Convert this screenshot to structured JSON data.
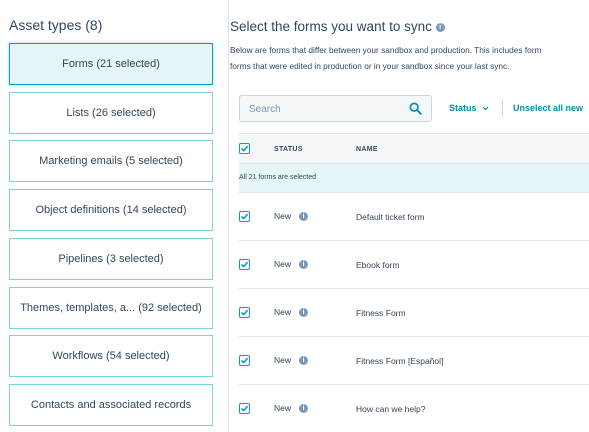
{
  "sidebar": {
    "title": "Asset types (8)",
    "items": [
      {
        "label": "Forms (21 selected)",
        "selected": true
      },
      {
        "label": "Lists (26 selected)",
        "selected": false
      },
      {
        "label": "Marketing emails (5 selected)",
        "selected": false
      },
      {
        "label": "Object definitions (14 selected)",
        "selected": false
      },
      {
        "label": "Pipelines (3 selected)",
        "selected": false
      },
      {
        "label": "Themes, templates, a... (92 selected)",
        "selected": false
      },
      {
        "label": "Workflows (54 selected)",
        "selected": false
      },
      {
        "label": "Contacts and associated records",
        "selected": false
      }
    ]
  },
  "main": {
    "title": "Select the forms you want to sync",
    "description_line1": "Below are forms that differ between your sandbox and production. This includes form",
    "description_line2": "forms that were edited in production or in your sandbox since your last sync.",
    "search": {
      "placeholder": "Search",
      "value": ""
    },
    "status_filter": "Status",
    "unselect_all": "Unselect all new",
    "table": {
      "headers": {
        "status": "STATUS",
        "name": "NAME"
      },
      "selection_note": "All 21 forms are selected",
      "rows": [
        {
          "status": "New",
          "name": "Default ticket form",
          "checked": true
        },
        {
          "status": "New",
          "name": "Ebook form",
          "checked": true
        },
        {
          "status": "New",
          "name": "Fitness Form",
          "checked": true
        },
        {
          "status": "New",
          "name": "Fitness Form [Español]",
          "checked": true
        },
        {
          "status": "New",
          "name": "How can we help?",
          "checked": true
        }
      ]
    }
  },
  "colors": {
    "accent": "#00a4bd",
    "link": "#0091ae",
    "text": "#33475b",
    "selected_bg": "#e5f5f8"
  },
  "icons": [
    "info-icon",
    "search-icon",
    "chevron-down-icon",
    "checkbox-checked-icon"
  ]
}
